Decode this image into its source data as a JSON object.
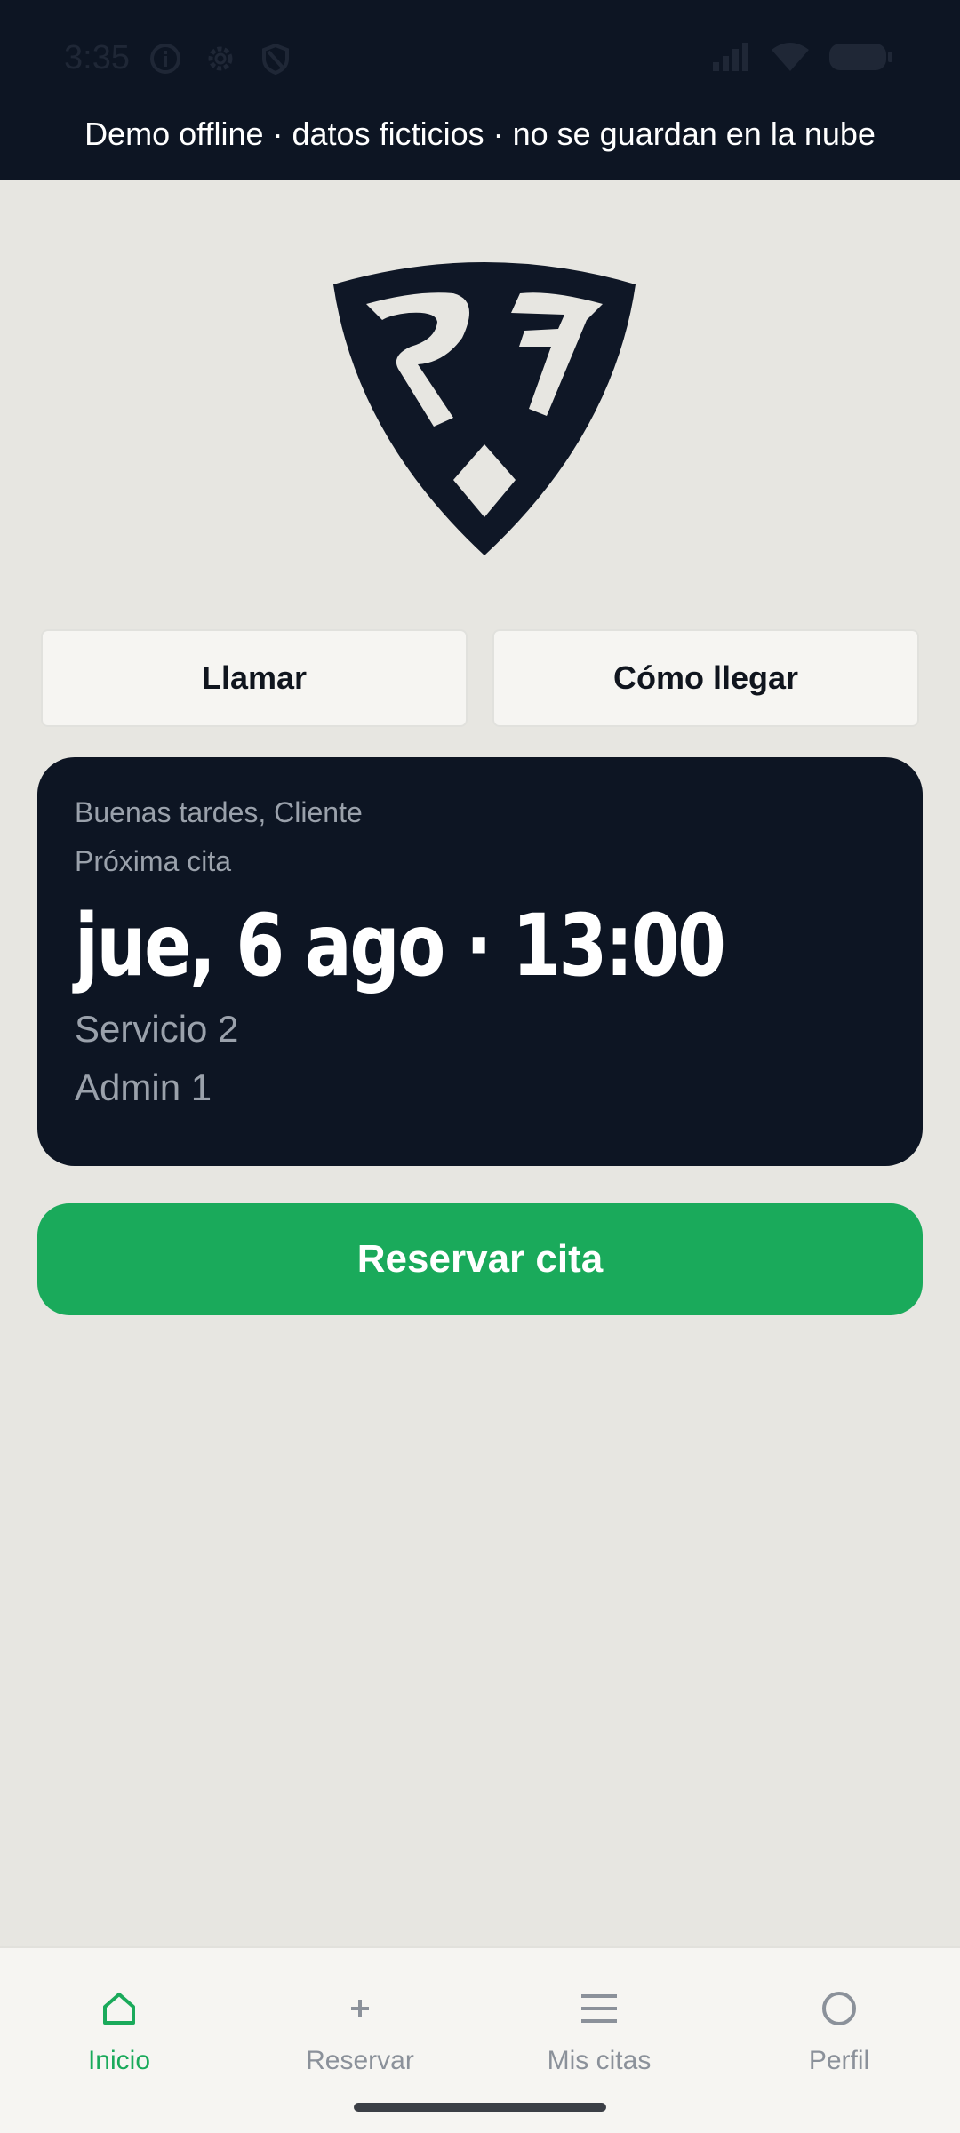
{
  "status_bar": {
    "time": "3:35",
    "icons": [
      "info-icon",
      "gear-icon",
      "shield-icon",
      "signal-icon",
      "wifi-icon",
      "battery-icon"
    ]
  },
  "banner": {
    "text": "Demo offline · datos ficticios · no se guardan en la nube"
  },
  "actions": {
    "call_label": "Llamar",
    "directions_label": "Cómo llegar"
  },
  "appointment": {
    "greeting": "Buenas tardes, Cliente",
    "next_label": "Próxima cita",
    "datetime": "jue, 6 ago · 13:00",
    "service": "Servicio 2",
    "staff": "Admin 1"
  },
  "book_button": {
    "label": "Reservar cita"
  },
  "bottom_nav": {
    "items": [
      {
        "label": "Inicio",
        "icon": "home-icon",
        "active": true
      },
      {
        "label": "Reservar",
        "icon": "plus-icon",
        "active": false
      },
      {
        "label": "Mis citas",
        "icon": "list-icon",
        "active": false
      },
      {
        "label": "Perfil",
        "icon": "profile-icon",
        "active": false
      }
    ]
  },
  "colors": {
    "dark": "#0d1523",
    "accent_green": "#1aaa5b",
    "background": "#e7e6e1"
  }
}
